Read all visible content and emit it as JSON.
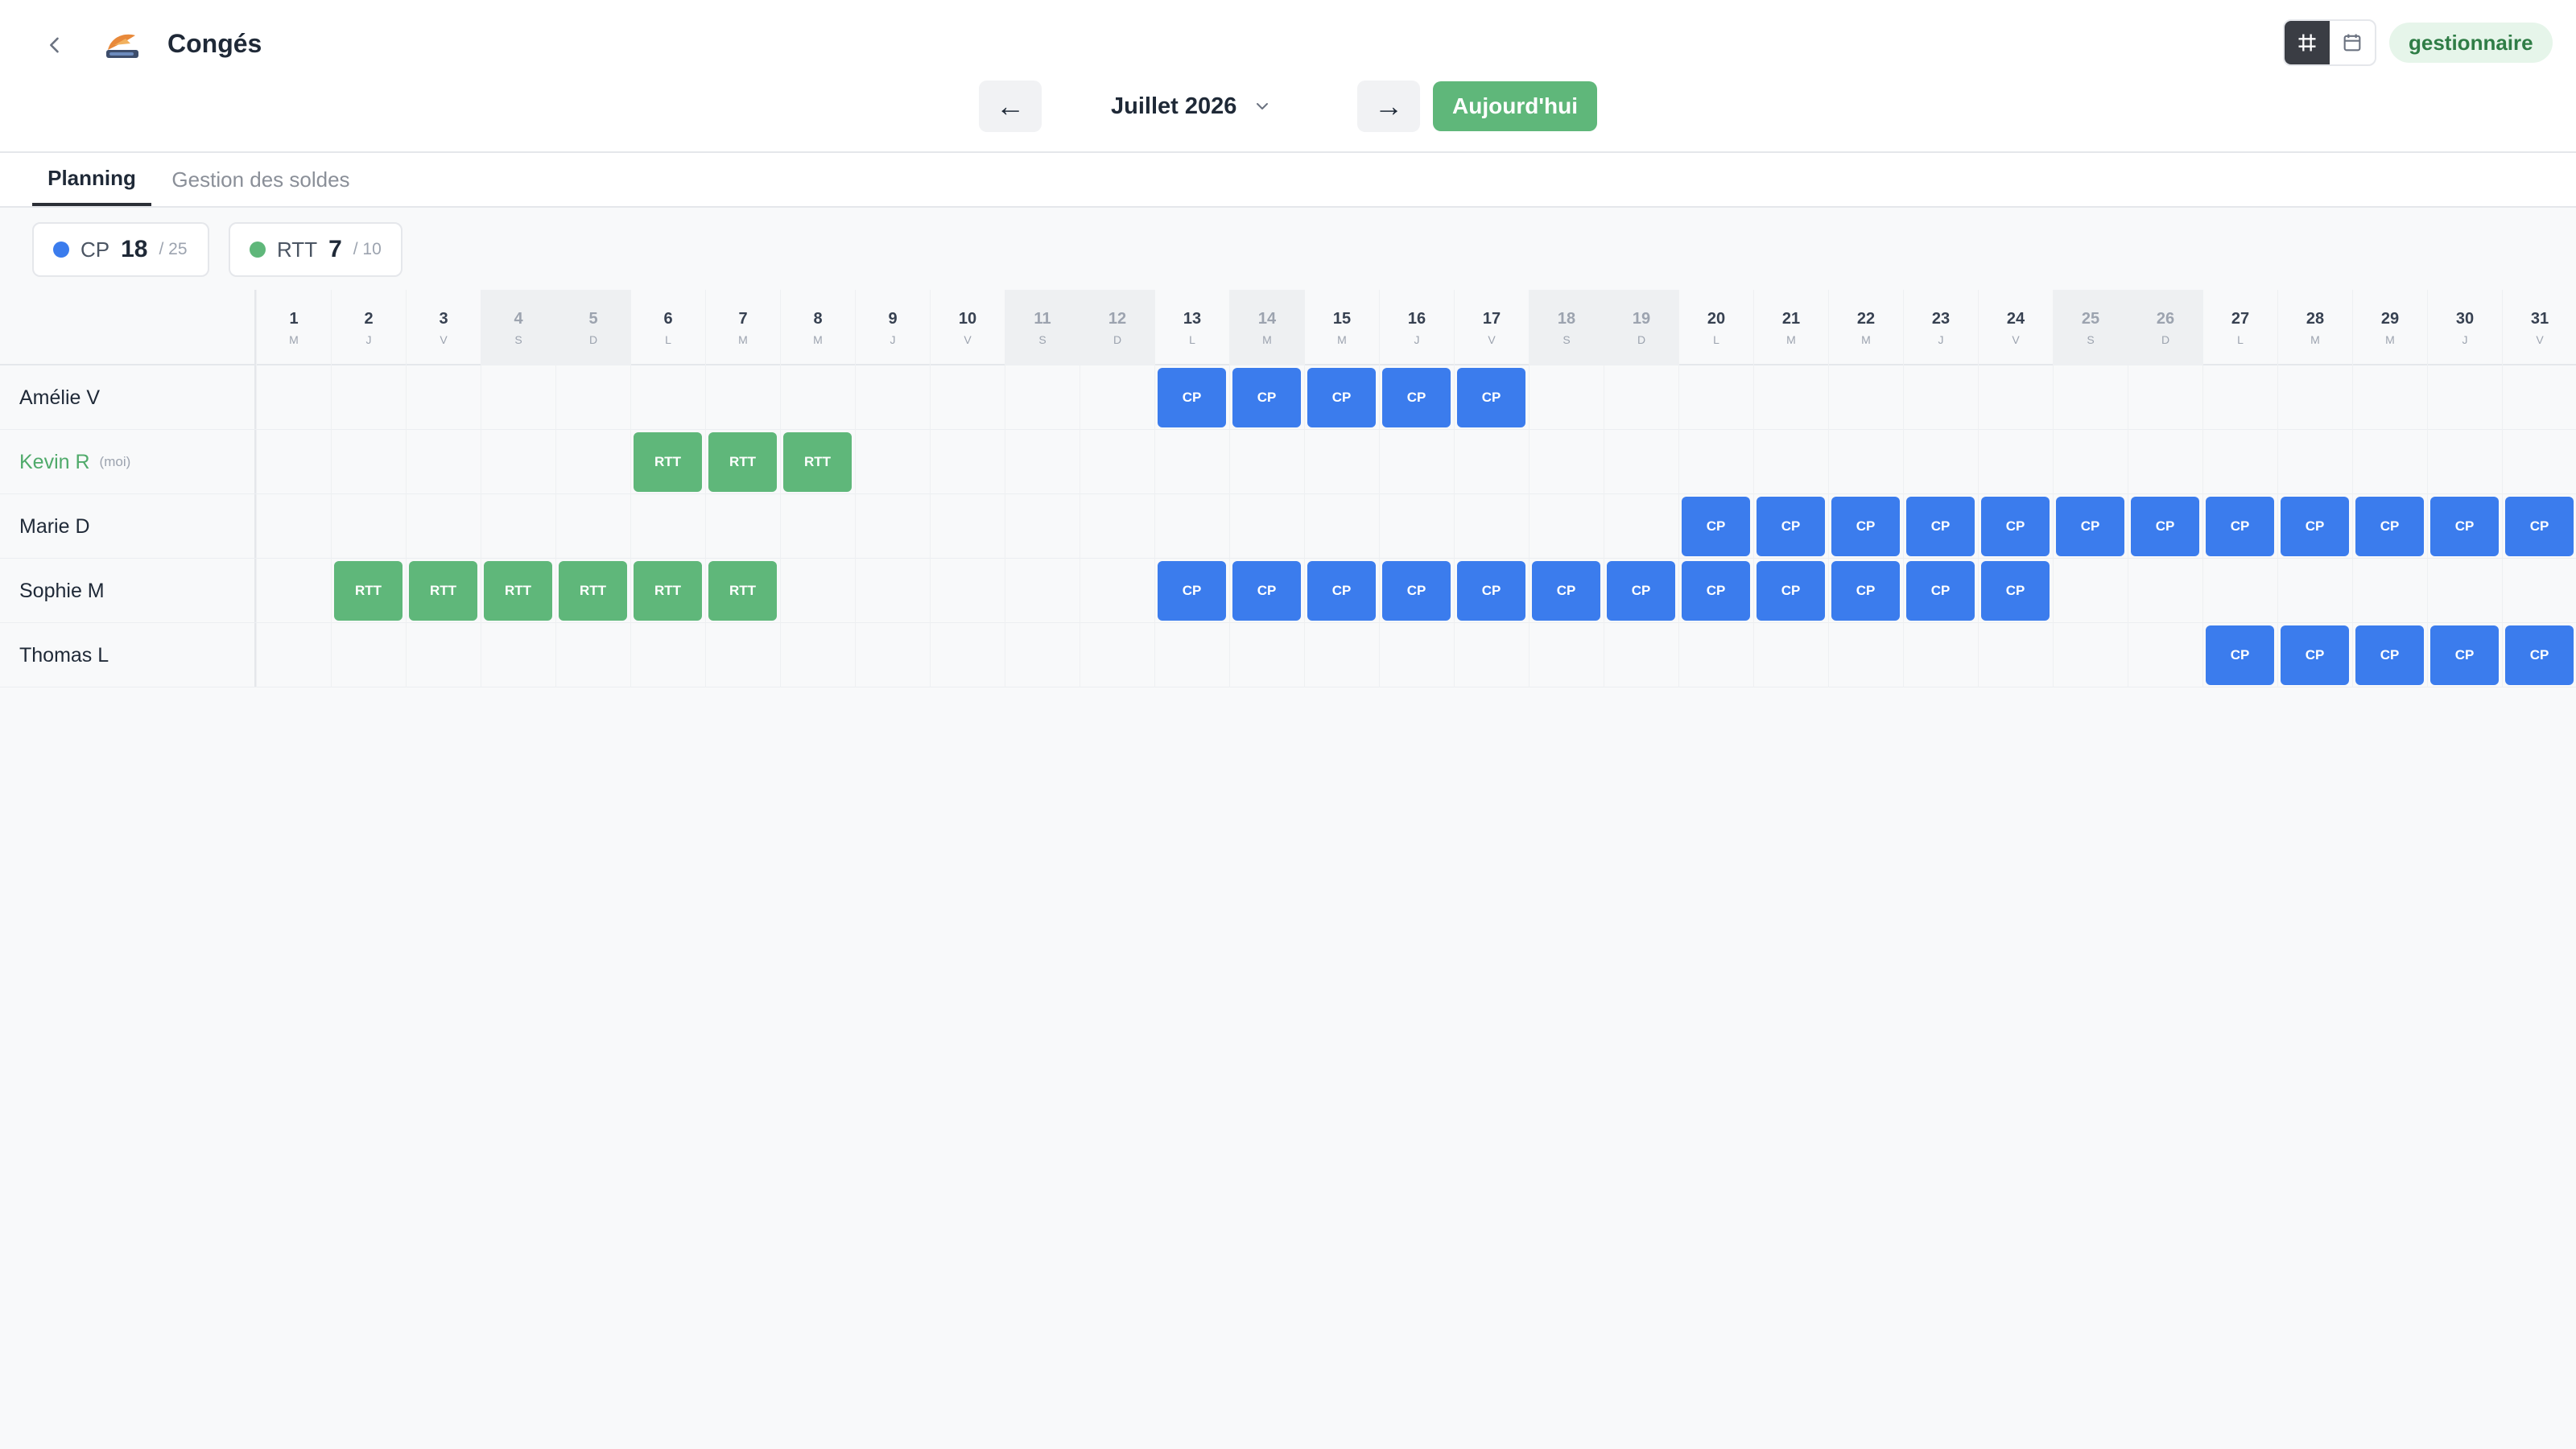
{
  "header": {
    "title": "Congés",
    "month_label": "Juillet 2026",
    "prev_label": "←",
    "next_label": "→",
    "today_label": "Aujourd'hui",
    "role_badge": "gestionnaire"
  },
  "tabs": [
    {
      "label": "Planning",
      "active": true
    },
    {
      "label": "Gestion des soldes",
      "active": false
    }
  ],
  "balances": [
    {
      "code": "CP",
      "count": "18",
      "total": "/ 25",
      "color": "#3b7ced"
    },
    {
      "code": "RTT",
      "count": "7",
      "total": "/ 10",
      "color": "#5fb77a"
    }
  ],
  "days": [
    {
      "n": "1",
      "l": "M",
      "weekend": false
    },
    {
      "n": "2",
      "l": "J",
      "weekend": false
    },
    {
      "n": "3",
      "l": "V",
      "weekend": false
    },
    {
      "n": "4",
      "l": "S",
      "weekend": true
    },
    {
      "n": "5",
      "l": "D",
      "weekend": true
    },
    {
      "n": "6",
      "l": "L",
      "weekend": false
    },
    {
      "n": "7",
      "l": "M",
      "weekend": false
    },
    {
      "n": "8",
      "l": "M",
      "weekend": false
    },
    {
      "n": "9",
      "l": "J",
      "weekend": false
    },
    {
      "n": "10",
      "l": "V",
      "weekend": false
    },
    {
      "n": "11",
      "l": "S",
      "weekend": true
    },
    {
      "n": "12",
      "l": "D",
      "weekend": true
    },
    {
      "n": "13",
      "l": "L",
      "weekend": false
    },
    {
      "n": "14",
      "l": "M",
      "weekend": true
    },
    {
      "n": "15",
      "l": "M",
      "weekend": false
    },
    {
      "n": "16",
      "l": "J",
      "weekend": false
    },
    {
      "n": "17",
      "l": "V",
      "weekend": false
    },
    {
      "n": "18",
      "l": "S",
      "weekend": true
    },
    {
      "n": "19",
      "l": "D",
      "weekend": true
    },
    {
      "n": "20",
      "l": "L",
      "weekend": false
    },
    {
      "n": "21",
      "l": "M",
      "weekend": false
    },
    {
      "n": "22",
      "l": "M",
      "weekend": false
    },
    {
      "n": "23",
      "l": "J",
      "weekend": false
    },
    {
      "n": "24",
      "l": "V",
      "weekend": false
    },
    {
      "n": "25",
      "l": "S",
      "weekend": true
    },
    {
      "n": "26",
      "l": "D",
      "weekend": true
    },
    {
      "n": "27",
      "l": "L",
      "weekend": false
    },
    {
      "n": "28",
      "l": "M",
      "weekend": false
    },
    {
      "n": "29",
      "l": "M",
      "weekend": false
    },
    {
      "n": "30",
      "l": "J",
      "weekend": false
    },
    {
      "n": "31",
      "l": "V",
      "weekend": false
    }
  ],
  "employees": [
    {
      "name": "Amélie V",
      "tag": "",
      "me": false,
      "leaves": [
        {
          "day": 13,
          "type": "CP"
        },
        {
          "day": 14,
          "type": "CP"
        },
        {
          "day": 15,
          "type": "CP"
        },
        {
          "day": 16,
          "type": "CP"
        },
        {
          "day": 17,
          "type": "CP"
        }
      ]
    },
    {
      "name": "Kevin R",
      "tag": "(moi)",
      "me": true,
      "leaves": [
        {
          "day": 6,
          "type": "RTT"
        },
        {
          "day": 7,
          "type": "RTT"
        },
        {
          "day": 8,
          "type": "RTT"
        }
      ]
    },
    {
      "name": "Marie D",
      "tag": "",
      "me": false,
      "leaves": [
        {
          "day": 20,
          "type": "CP"
        },
        {
          "day": 21,
          "type": "CP"
        },
        {
          "day": 22,
          "type": "CP"
        },
        {
          "day": 23,
          "type": "CP"
        },
        {
          "day": 24,
          "type": "CP"
        },
        {
          "day": 25,
          "type": "CP"
        },
        {
          "day": 26,
          "type": "CP"
        },
        {
          "day": 27,
          "type": "CP"
        },
        {
          "day": 28,
          "type": "CP"
        },
        {
          "day": 29,
          "type": "CP"
        },
        {
          "day": 30,
          "type": "CP"
        },
        {
          "day": 31,
          "type": "CP"
        }
      ]
    },
    {
      "name": "Sophie M",
      "tag": "",
      "me": false,
      "leaves": [
        {
          "day": 2,
          "type": "RTT"
        },
        {
          "day": 3,
          "type": "RTT"
        },
        {
          "day": 4,
          "type": "RTT"
        },
        {
          "day": 5,
          "type": "RTT"
        },
        {
          "day": 6,
          "type": "RTT"
        },
        {
          "day": 7,
          "type": "RTT"
        },
        {
          "day": 13,
          "type": "CP"
        },
        {
          "day": 14,
          "type": "CP"
        },
        {
          "day": 15,
          "type": "CP"
        },
        {
          "day": 16,
          "type": "CP"
        },
        {
          "day": 17,
          "type": "CP"
        },
        {
          "day": 18,
          "type": "CP"
        },
        {
          "day": 19,
          "type": "CP"
        },
        {
          "day": 20,
          "type": "CP"
        },
        {
          "day": 21,
          "type": "CP"
        },
        {
          "day": 22,
          "type": "CP"
        },
        {
          "day": 23,
          "type": "CP"
        },
        {
          "day": 24,
          "type": "CP"
        }
      ]
    },
    {
      "name": "Thomas L",
      "tag": "",
      "me": false,
      "leaves": [
        {
          "day": 27,
          "type": "CP"
        },
        {
          "day": 28,
          "type": "CP"
        },
        {
          "day": 29,
          "type": "CP"
        },
        {
          "day": 30,
          "type": "CP"
        },
        {
          "day": 31,
          "type": "CP"
        }
      ]
    }
  ],
  "leave_colors": {
    "CP": "#3b7ced",
    "RTT": "#5fb77a"
  }
}
